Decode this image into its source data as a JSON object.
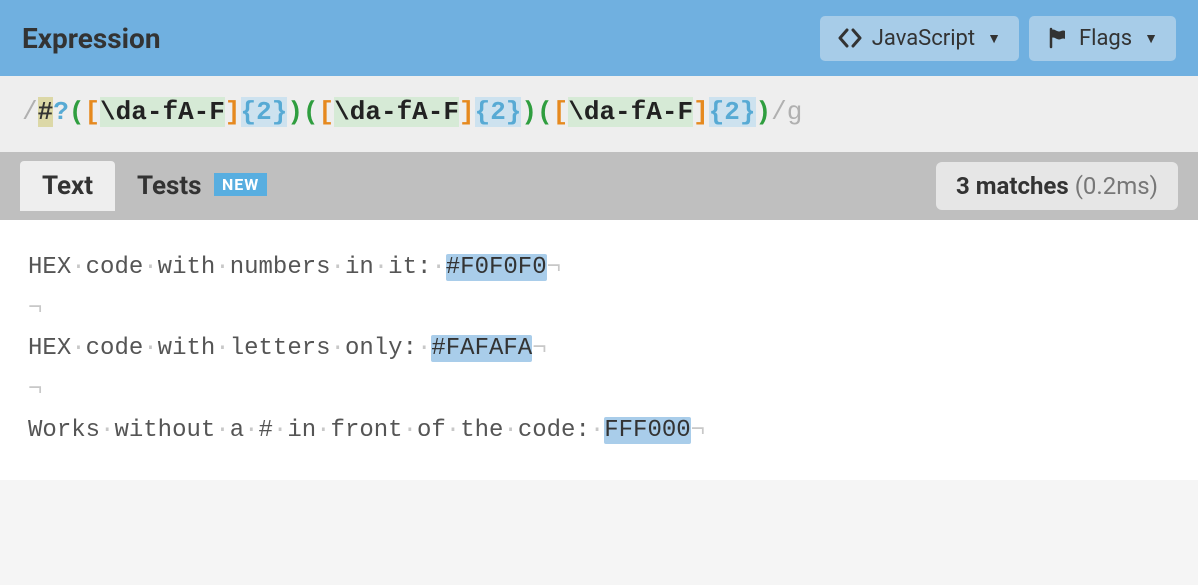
{
  "header": {
    "title": "Expression",
    "flavor_label": "JavaScript",
    "flags_label": "Flags"
  },
  "regex": {
    "open_slash": "/",
    "close_slash": "/",
    "flags": "g",
    "literal_hash": "#",
    "question": "?",
    "group_open": "(",
    "group_close": ")",
    "set_open": "[",
    "set_close": "]",
    "esc_d": "\\d",
    "range1": "a-f",
    "range2": "A-F",
    "quant": "{2}"
  },
  "tabs": {
    "text": "Text",
    "tests": "Tests",
    "new_badge": "NEW"
  },
  "results": {
    "match_count_label": "3 matches",
    "timing": "(0.2ms)"
  },
  "test_text": {
    "lines": [
      {
        "pre": "HEX code with numbers in it: ",
        "match": "#F0F0F0"
      },
      {
        "pre": "",
        "match": ""
      },
      {
        "pre": "HEX code with letters only: ",
        "match": "#FAFAFA"
      },
      {
        "pre": "",
        "match": ""
      },
      {
        "pre": "Works without a # in front of the code: ",
        "match": "FFF000"
      }
    ]
  }
}
